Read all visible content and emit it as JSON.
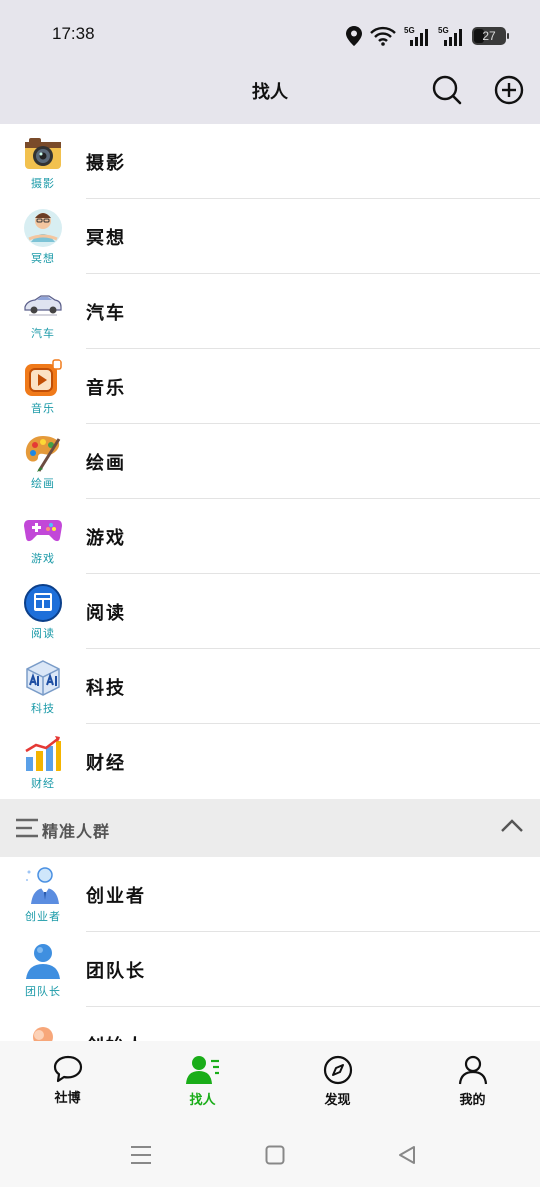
{
  "status_bar": {
    "time": "17:38",
    "battery": "27",
    "icons": [
      "location-icon",
      "wifi-icon",
      "signal-5g-icon",
      "signal-5g-icon",
      "battery-icon"
    ]
  },
  "header": {
    "title": "找人"
  },
  "categories": [
    {
      "label": "摄影",
      "icon_label": "摄影",
      "icon": "camera-icon"
    },
    {
      "label": "冥想",
      "icon_label": "冥想",
      "icon": "meditation-icon"
    },
    {
      "label": "汽车",
      "icon_label": "汽车",
      "icon": "car-icon"
    },
    {
      "label": "音乐",
      "icon_label": "音乐",
      "icon": "music-icon"
    },
    {
      "label": "绘画",
      "icon_label": "绘画",
      "icon": "palette-icon"
    },
    {
      "label": "游戏",
      "icon_label": "游戏",
      "icon": "gamepad-icon"
    },
    {
      "label": "阅读",
      "icon_label": "阅读",
      "icon": "reading-icon"
    },
    {
      "label": "科技",
      "icon_label": "科技",
      "icon": "ai-icon"
    },
    {
      "label": "财经",
      "icon_label": "财经",
      "icon": "finance-chart-icon"
    }
  ],
  "section": {
    "title": "精准人群"
  },
  "groups": [
    {
      "label": "创业者",
      "icon_label": "创业者",
      "icon": "entrepreneur-icon"
    },
    {
      "label": "团队长",
      "icon_label": "团队长",
      "icon": "team-leader-icon"
    },
    {
      "label": "创始人",
      "icon_label": "",
      "icon": "founder-icon"
    }
  ],
  "bottom_nav": {
    "items": [
      {
        "label": "社博",
        "icon": "chat-bubble-icon"
      },
      {
        "label": "找人",
        "icon": "find-people-icon",
        "active": true
      },
      {
        "label": "发现",
        "icon": "compass-icon"
      },
      {
        "label": "我的",
        "icon": "user-icon"
      }
    ]
  },
  "colors": {
    "accent": "#1aad19",
    "header_bg": "#e6e5ec",
    "icon_label": "#1b9aa8"
  }
}
